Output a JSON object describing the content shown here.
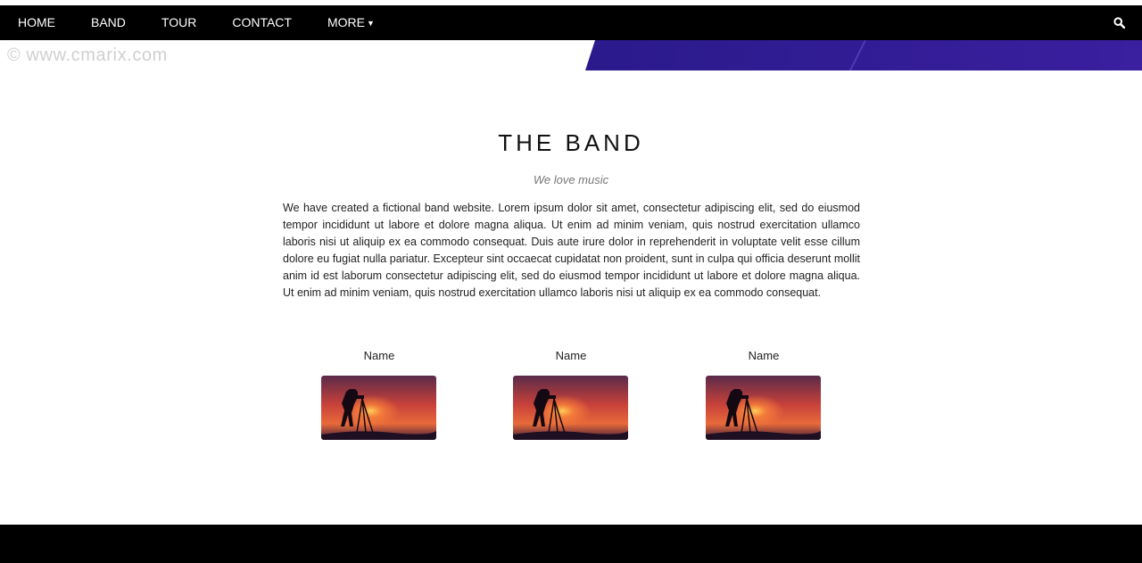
{
  "nav": {
    "items": [
      {
        "label": "HOME"
      },
      {
        "label": "BAND"
      },
      {
        "label": "TOUR"
      },
      {
        "label": "CONTACT"
      },
      {
        "label": "MORE",
        "has_dropdown": true
      }
    ],
    "search_icon": "search-icon"
  },
  "watermark": "© www.cmarix.com",
  "band": {
    "title": "THE BAND",
    "subtitle": "We love music",
    "description": "We have created a fictional band website. Lorem ipsum dolor sit amet, consectetur adipiscing elit, sed do eiusmod tempor incididunt ut labore et dolore magna aliqua. Ut enim ad minim veniam, quis nostrud exercitation ullamco laboris nisi ut aliquip ex ea commodo consequat. Duis aute irure dolor in reprehenderit in voluptate velit esse cillum dolore eu fugiat nulla pariatur. Excepteur sint occaecat cupidatat non proident, sunt in culpa qui officia deserunt mollit anim id est laborum consectetur adipiscing elit, sed do eiusmod tempor incididunt ut labore et dolore magna aliqua. Ut enim ad minim veniam, quis nostrud exercitation ullamco laboris nisi ut aliquip ex ea commodo consequat."
  },
  "members": [
    {
      "name": "Name"
    },
    {
      "name": "Name"
    },
    {
      "name": "Name"
    }
  ],
  "colors": {
    "nav_bg": "#000000",
    "banner_accent": "#2a1a8c",
    "footer_bg": "#000000"
  }
}
